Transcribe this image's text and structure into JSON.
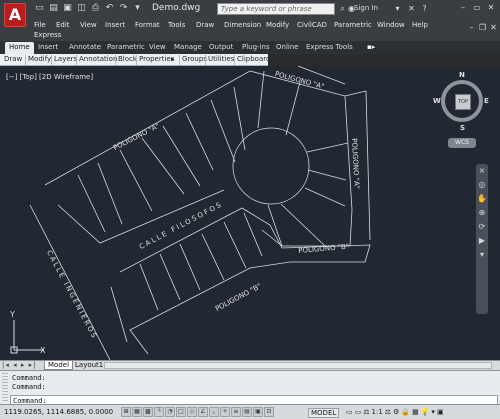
{
  "title_bar": {
    "app_logo": "A",
    "doc_title": "Demo.dwg",
    "search_placeholder": "Type a keyword or phrase",
    "sign_in": "Sign In",
    "help": "?"
  },
  "menu": {
    "items": [
      "File",
      "Edit",
      "View",
      "Insert",
      "Format",
      "Tools",
      "Draw",
      "Dimension",
      "Modify",
      "CivilCAD",
      "Parametric",
      "Window",
      "Help"
    ],
    "express": "Express"
  },
  "ribbon": {
    "tabs": [
      "Home",
      "Insert",
      "Annotate",
      "Parametric",
      "View",
      "Manage",
      "Output",
      "Plug-ins",
      "Online",
      "Express Tools"
    ],
    "panels": [
      "Draw",
      "Modify",
      "Layers",
      "Annotation",
      "Block",
      "Properties",
      "Groups",
      "Utilities",
      "Clipboard"
    ]
  },
  "viewport": {
    "label": "[−] [Top] [2D Wireframe]",
    "viewcube": {
      "top": "TOP",
      "north": "N",
      "south": "S",
      "east": "E",
      "west": "W"
    },
    "wcs": "WCS",
    "ucs": {
      "y": "Y",
      "x": "X"
    }
  },
  "drawing_labels": {
    "poligono_a_top": "POLIGONO \"A\"",
    "poligono_a_left": "POLIGONO \"A\"",
    "poligono_a_right": "POLIGONO \"A\"",
    "poligono_b_right": "POLIGONO \"B\"",
    "poligono_b_bottom": "POLIGONO \"B\"",
    "calle_filosofos": "CALLE FILOSOFOS",
    "calle_ingenieros": "CALLE INGENIEROS"
  },
  "layout_tabs": {
    "items": [
      "Model",
      "Layout1"
    ],
    "active": "Model"
  },
  "command": {
    "history": [
      "Command:",
      "Command:"
    ],
    "prompt": "Command:"
  },
  "status": {
    "coordinates": "1119.0265, 1114.6885, 0.0000",
    "model": "MODEL",
    "scale": "1:1"
  }
}
